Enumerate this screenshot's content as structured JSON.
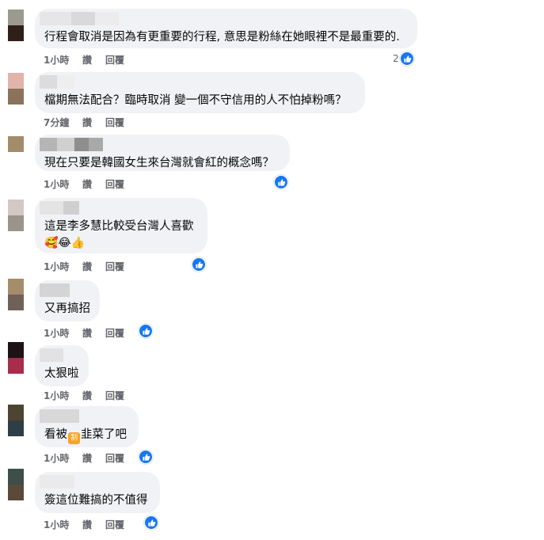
{
  "comments": [
    {
      "text": "行程會取消是因為有更重要的行程, 意思是粉絲在她眼裡不是最重要的.",
      "time": "1小時",
      "like": "讚",
      "reply": "回覆",
      "reaction_count": "2",
      "avatar_colors": [
        "#9a9a8e",
        "#2e2018"
      ]
    },
    {
      "text": "檔期無法配合？臨時取消 變一個不守信用的人不怕掉粉嗎？",
      "time": "7分鐘",
      "like": "讚",
      "reply": "回覆",
      "avatar_colors": [
        "#e2b3aa",
        "#8b725c"
      ]
    },
    {
      "text": "現在只要是韓國女生來台灣就會紅的概念嗎？",
      "time": "1小時",
      "like": "讚",
      "reply": "回覆",
      "avatar_colors": [
        "#a38c6a",
        "#a38c6a"
      ]
    },
    {
      "text": "這是李多慧比較受台灣人喜歡",
      "emojis": "🥰😂👍",
      "time": "1小時",
      "like": "讚",
      "reply": "回覆",
      "avatar_colors": [
        "#d2c9c4",
        "#9a948a"
      ]
    },
    {
      "text": "又再搞招",
      "time": "1小時",
      "like": "讚",
      "reply": "回覆",
      "avatar_colors": [
        "#a58c6b",
        "#6e6258"
      ]
    },
    {
      "text": "太狠啦",
      "time": "1小時",
      "like": "讚",
      "reply": "回覆",
      "avatar_colors": [
        "#1e1216",
        "#a82c4c"
      ]
    },
    {
      "text_before": "看被",
      "sticker_text": "割",
      "text_after": "韭菜了吧",
      "time": "1小時",
      "like": "讚",
      "reply": "回覆",
      "avatar_colors": [
        "#4d4532",
        "#2e3e46"
      ]
    },
    {
      "text": "簽這位難搞的不值得",
      "time": "1小時",
      "like": "讚",
      "reply": "回覆",
      "avatar_colors": [
        "#3e4e48",
        "#594a3a"
      ]
    }
  ],
  "colors": {
    "bubble": "#f0f2f5",
    "like_blue": "#1877f2",
    "meta_gray": "#65676b"
  },
  "icons": {
    "reaction": "thumbs-up-icon"
  }
}
